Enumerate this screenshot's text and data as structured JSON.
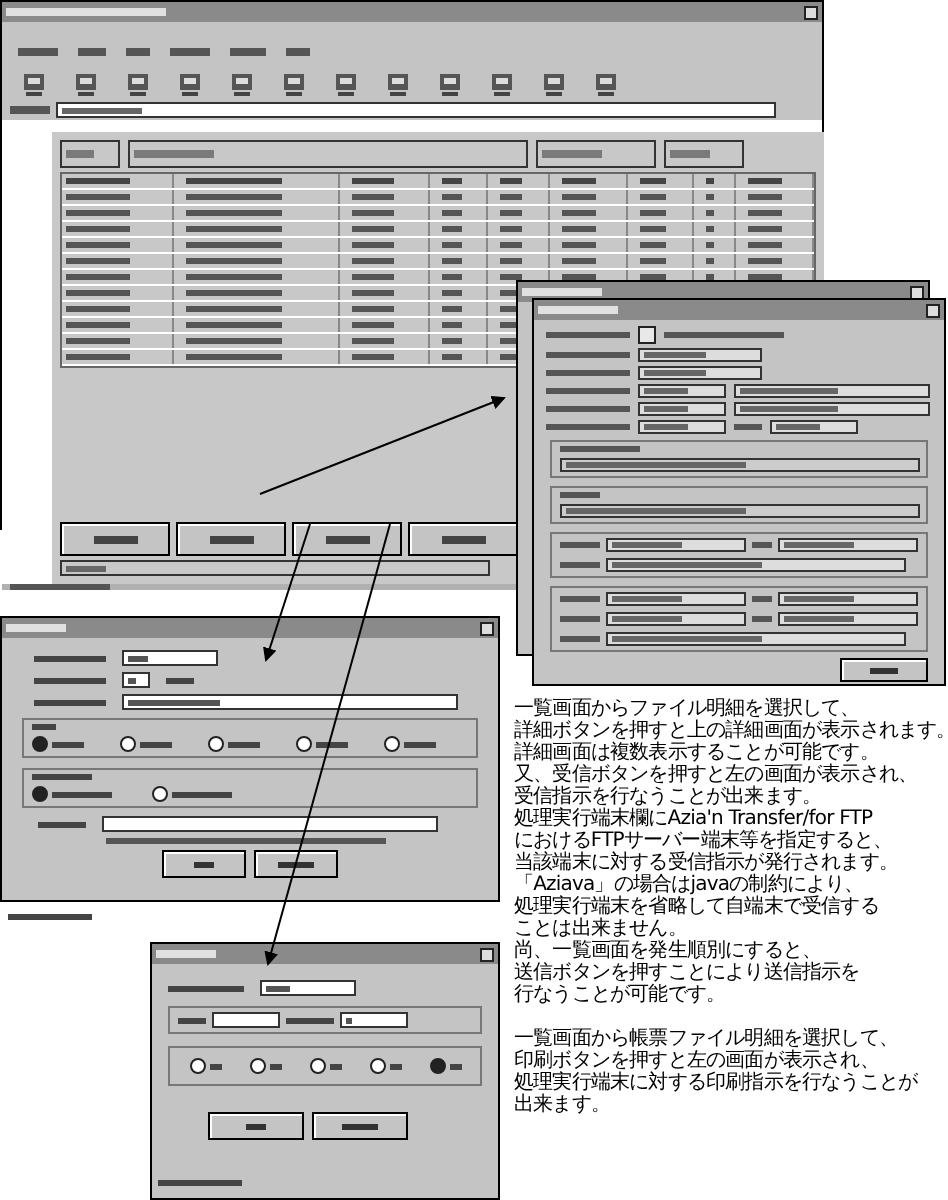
{
  "description": {
    "paragraphs": [
      [
        "一覧画面からファイル明細を選択して、",
        "詳細ボタンを押すと上の詳細画面が表示されます。",
        "詳細画面は複数表示することが可能です。",
        "又、受信ボタンを押すと左の画面が表示され、",
        "受信指示を行なうことが出来ます。",
        "処理実行端末欄にAzia'n Transfer/for FTP",
        "におけるFTPサーバー端末等を指定すると、",
        "当該端末に対する受信指示が発行されます。",
        "「Aziava」の場合はjavaの制約により、",
        "処理実行端末を省略して自端末で受信する",
        "ことは出来ません。",
        "尚、一覧画面を発生順別にすると、",
        "送信ボタンを押すことにより送信指示を",
        "行なうことが可能です。"
      ],
      [
        "一覧画面から帳票ファイル明細を選択して、",
        "印刷ボタンを押すと左の画面が表示され、",
        "処理実行端末に対する印刷指示を行なうことが",
        "出来ます。"
      ]
    ]
  },
  "detail_window": {
    "checked": false
  },
  "receive_dialog": {
    "mode_options": [
      {
        "selected": true
      },
      {
        "selected": false
      },
      {
        "selected": false
      },
      {
        "selected": false
      },
      {
        "selected": false
      }
    ],
    "code_options": [
      {
        "selected": true
      },
      {
        "selected": false
      }
    ]
  },
  "print_dialog": {
    "options": [
      {
        "selected": false
      },
      {
        "selected": false
      },
      {
        "selected": false
      },
      {
        "selected": false
      },
      {
        "selected": true
      }
    ]
  }
}
